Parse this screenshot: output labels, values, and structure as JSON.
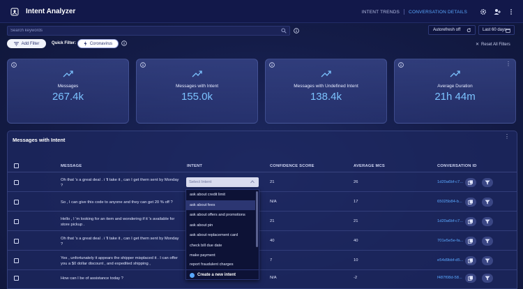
{
  "app": {
    "title": "Intent Analyzer"
  },
  "nav": {
    "items": [
      "INTENT TRENDS",
      "CONVERSATION DETAILS"
    ],
    "active": "CONVERSATION DETAILS"
  },
  "search": {
    "placeholder": "Search keywords"
  },
  "filters": {
    "add_filter": "Add Filter",
    "quick_filter_label": "Quick Filter:",
    "quick_filter_value": "Coronavirus",
    "reset": "Reset All Filters"
  },
  "controls": {
    "autorefresh": "Autorefresh off",
    "range": "Last 60 days"
  },
  "cards": [
    {
      "label": "Messages",
      "value": "267.4k"
    },
    {
      "label": "Messages with Intent",
      "value": "155.0k"
    },
    {
      "label": "Messages with Undefined Intent",
      "value": "138.4k"
    },
    {
      "label": "Average Duration",
      "value": "21h 44m"
    }
  ],
  "table": {
    "title": "Messages with Intent",
    "columns": [
      "MESSAGE",
      "INTENT",
      "CONFIDENCE SCORE",
      "AVERAGE MCS",
      "CONVERSATION ID"
    ],
    "rows": [
      {
        "message": "Oh that 's a great deal . i 'll take it , can I get them sent by Monday ?",
        "confidence": "21",
        "mcs": "26",
        "conv_id": "1d20a6bf-c7..."
      },
      {
        "message": "So , I can give this code to anyone and they can get 20 % off ?",
        "confidence": "N/A",
        "mcs": "17",
        "conv_id": "65025b84-b..."
      },
      {
        "message": "Hello , I 'm looking for an item and wondering if it 's available for store pickup .",
        "confidence": "21",
        "mcs": "21",
        "conv_id": "1d20a6bf-c7..."
      },
      {
        "message": "Oh that 's a great deal . i 'll take it , can I get them sent by Monday ?",
        "confidence": "40",
        "mcs": "40",
        "conv_id": "701e5e5e-fa..."
      },
      {
        "message": "Yes , unfortunately it appears the shipper misplaced it . I can offer you a $0 dollar discount , and expedited shipping ,",
        "confidence": "7",
        "mcs": "10",
        "conv_id": "e54d9bbf-d5..."
      },
      {
        "message": "How can I be of assistance today ?",
        "confidence": "N/A",
        "mcs": "-2",
        "conv_id": "f487f08d-58..."
      }
    ]
  },
  "intent_select": {
    "placeholder": "Select Intent",
    "options": [
      "ask about credit limit",
      "ask about fees",
      "ask about offers and promotions",
      "ask about pin",
      "ask about replacement card",
      "check bill due date",
      "make payment",
      "report fraudulent charges"
    ],
    "highlighted": "ask about fees",
    "create_label": "Create a new intent"
  },
  "colors": {
    "accent": "#5aa8ff",
    "value": "#7cc3ff",
    "background": "#141c48"
  }
}
